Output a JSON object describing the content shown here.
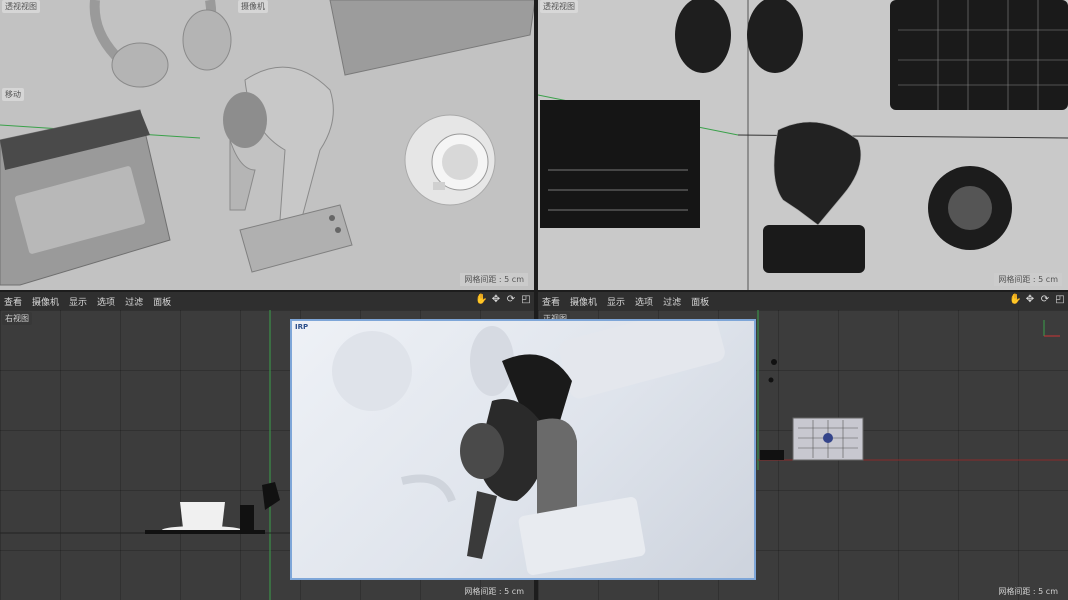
{
  "viewports": {
    "top_left": {
      "label": "透视视图",
      "camera_label": "摄像机",
      "tool_label": "移动",
      "grid": "网格间距 : 5 cm"
    },
    "top_right": {
      "label": "透视视图",
      "grid": "网格间距 : 5 cm"
    },
    "bottom_left": {
      "label": "右视图",
      "grid": "网格间距 : 5 cm"
    },
    "bottom_right": {
      "label": "正视图",
      "grid": "网格间距 : 5 cm"
    }
  },
  "toolbar_left": {
    "items": [
      "查看",
      "摄像机",
      "显示",
      "选项",
      "过滤",
      "面板"
    ]
  },
  "toolbar_right": {
    "items": [
      "查看",
      "摄像机",
      "显示",
      "选项",
      "过滤",
      "面板"
    ]
  },
  "render": {
    "badge": "IRP"
  },
  "icons": [
    "pan-icon",
    "move-icon",
    "rotate-icon",
    "maximize-icon"
  ]
}
